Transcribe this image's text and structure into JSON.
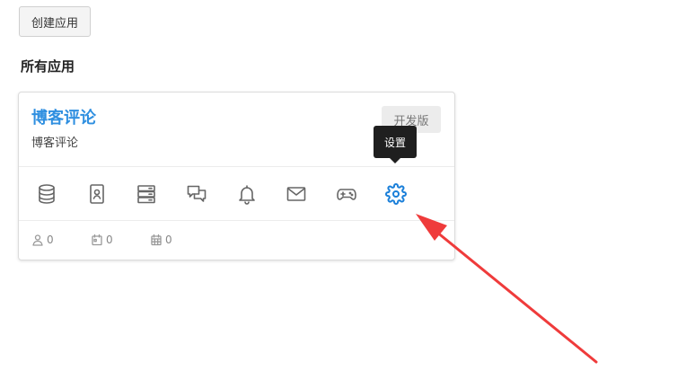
{
  "toolbar": {
    "create_label": "创建应用"
  },
  "section": {
    "title": "所有应用"
  },
  "app": {
    "name": "博客评论",
    "description": "博客评论",
    "badge": "开发版",
    "actions": [
      {
        "name": "database-icon"
      },
      {
        "name": "contact-card-icon"
      },
      {
        "name": "server-icon"
      },
      {
        "name": "chat-icon"
      },
      {
        "name": "bell-icon"
      },
      {
        "name": "mail-icon"
      },
      {
        "name": "gamepad-icon"
      },
      {
        "name": "gear-icon",
        "active": true
      }
    ],
    "stats": [
      {
        "icon": "user-icon",
        "value": "0"
      },
      {
        "icon": "calendar-icon",
        "value": "0"
      },
      {
        "icon": "calendar-grid-icon",
        "value": "0"
      }
    ]
  },
  "tooltip": {
    "text": "设置"
  },
  "colors": {
    "accent": "#1a7fd9",
    "app_name": "#2f8fe0",
    "tooltip_bg": "#1f1f1f",
    "annotation_arrow": "#ef3b3b"
  }
}
